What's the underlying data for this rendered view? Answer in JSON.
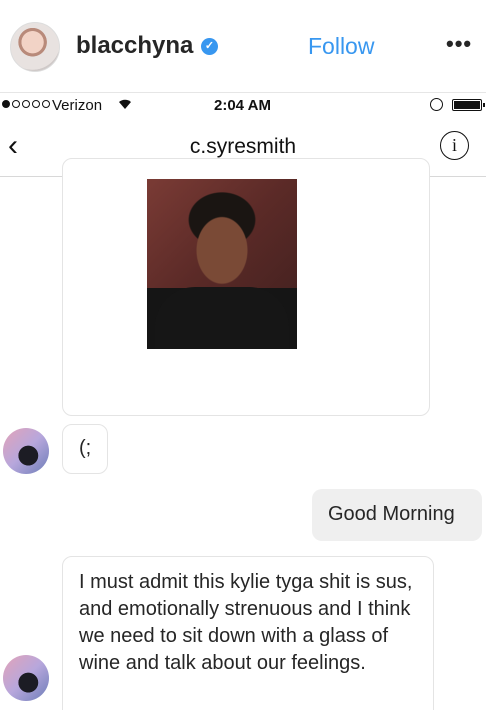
{
  "post_header": {
    "username": "blacchyna",
    "verified_glyph": "✓",
    "follow_label": "Follow",
    "more_glyph": "•••"
  },
  "status_bar": {
    "carrier": "Verizon",
    "time": "2:04 AM",
    "signal_bars_filled": 1,
    "signal_bars_total": 5
  },
  "dm_header": {
    "back_glyph": "‹",
    "title": "c.syresmith",
    "info_glyph": "i"
  },
  "messages": [
    {
      "sender": "them",
      "type": "photo"
    },
    {
      "sender": "them",
      "type": "text",
      "text": "(;"
    },
    {
      "sender": "me",
      "type": "text",
      "text": "Good Morning"
    },
    {
      "sender": "them",
      "type": "text",
      "text": "I must admit this kylie tyga shit is sus, and emotionally strenuous and I think we need to sit down with a glass of wine and talk about our feelings."
    }
  ],
  "colors": {
    "link_blue": "#3897f0",
    "my_bubble": "#efefef",
    "text": "#262626"
  },
  "icons": [
    "verified-icon",
    "more-icon",
    "wifi-icon",
    "lock-icon",
    "battery-icon",
    "back-icon",
    "info-icon"
  ]
}
